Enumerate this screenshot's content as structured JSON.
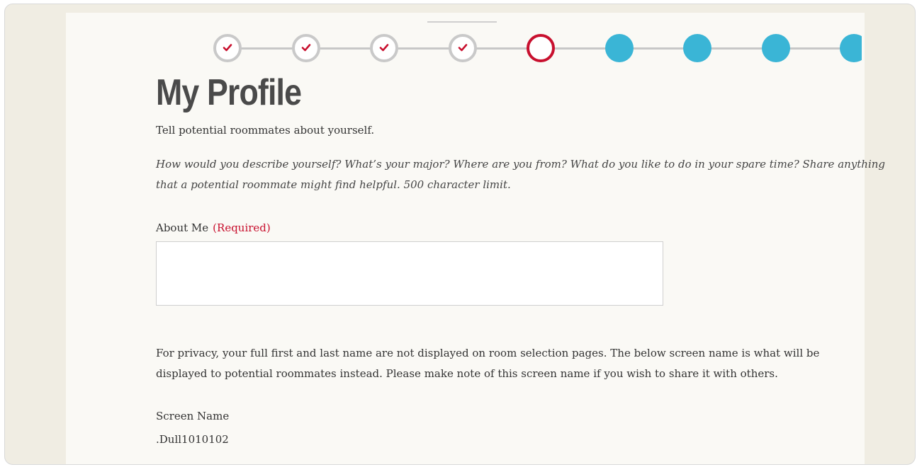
{
  "stepper": {
    "steps": [
      {
        "state": "done",
        "icon": "checkmark-icon"
      },
      {
        "state": "done",
        "icon": "checkmark-icon"
      },
      {
        "state": "done",
        "icon": "checkmark-icon"
      },
      {
        "state": "done",
        "icon": "checkmark-icon"
      },
      {
        "state": "current"
      },
      {
        "state": "todo"
      },
      {
        "state": "todo"
      },
      {
        "state": "todo"
      },
      {
        "state": "todo"
      }
    ],
    "colors": {
      "done_border": "#c9c9c9",
      "check": "#c8102e",
      "current_border": "#c8102e",
      "todo_fill": "#3ab5d6",
      "line": "#c7c7c7"
    }
  },
  "page": {
    "title": "My Profile",
    "intro": "Tell potential roommates about yourself.",
    "hint": "How would you describe yourself? What’s your major? Where are you from? What do you like to do in your spare time? Share anything that a potential roommate might find helpful. 500 character limit."
  },
  "about_me": {
    "label": "About Me",
    "required": "(Required)",
    "value": ""
  },
  "privacy_note": "For privacy, your full first and last name are not displayed on room selection pages. The below screen name is what will be displayed to potential roommates instead. Please make note of this screen name if you wish to share it with others.",
  "screen_name": {
    "label": "Screen Name",
    "value": ".Dull1010102"
  }
}
